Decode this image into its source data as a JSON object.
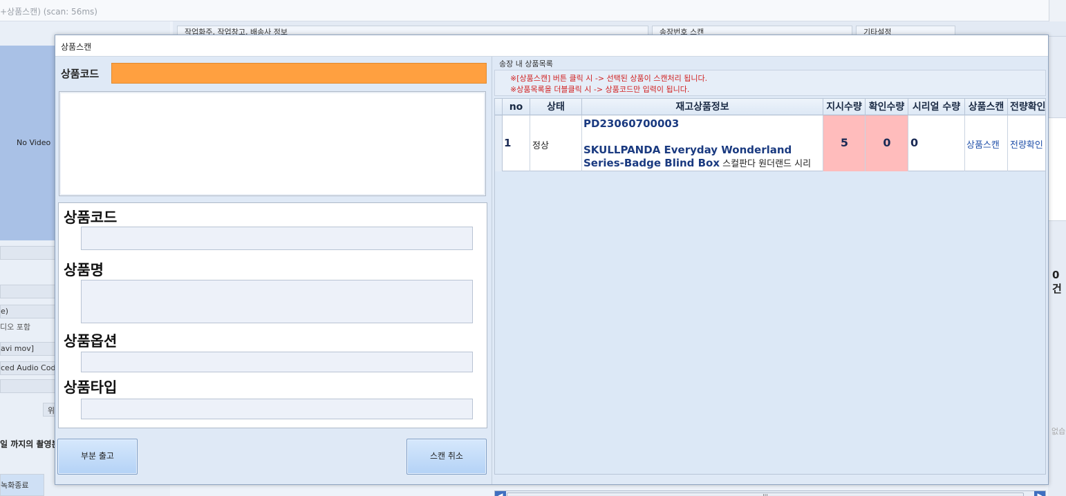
{
  "app": {
    "title": "+상품스캔) (scan: 56ms)",
    "video_placeholder": "No Video",
    "left_texts": {
      "row_e": "e)",
      "audio_incl": "디오 포함",
      "formats": "avi mov]",
      "codec": "ced Audio Coding",
      "btn_u": "위",
      "record_until": "일 까지의 촬영본",
      "record_end": "녹화종료"
    },
    "tabs": [
      "작업화주, 작업창고, 배송사 정보",
      "송장번호 스캔",
      "기타설정"
    ],
    "right_count": "0 건",
    "right_small": "없습"
  },
  "dialog": {
    "title": "상품스캔",
    "code_label": "상품코드",
    "info": {
      "code_label": "상품코드",
      "name_label": "상품명",
      "option_label": "상품옵션",
      "type_label": "상품타입"
    },
    "buttons": {
      "partial": "부분 출고",
      "cancel": "스캔 취소"
    },
    "list": {
      "header": "송장 내 상품목록",
      "notes": [
        "※[상품스캔] 버튼 클릭 시 -> 선택된 상품이 스캔처리 됩니다.",
        "※상품목록을 더블클릭 시  -> 상품코드만 입력이 됩니다."
      ],
      "columns": [
        "no",
        "상태",
        "재고상품정보",
        "지시수량",
        "확인수량",
        "시리얼 수량",
        "상품스캔",
        "전량확인"
      ],
      "rows": [
        {
          "no": "1",
          "status": "정상",
          "code": "PD23060700003",
          "name_bold": "SKULLPANDA Everyday Wonderland Series-Badge Blind Box",
          "name_tail": " 스컬판다 원더랜드 시리",
          "ordered": "5",
          "confirmed": "0",
          "serial": "0",
          "scan_link": "상품스캔",
          "all_link": "전량확인"
        }
      ],
      "scroll_grip": "|||"
    }
  },
  "colors": {
    "input_highlight": "#ffa040",
    "qty_cell": "#ffbcbc",
    "link_blue": "#1f4fa8",
    "note_red": "#d02020"
  }
}
